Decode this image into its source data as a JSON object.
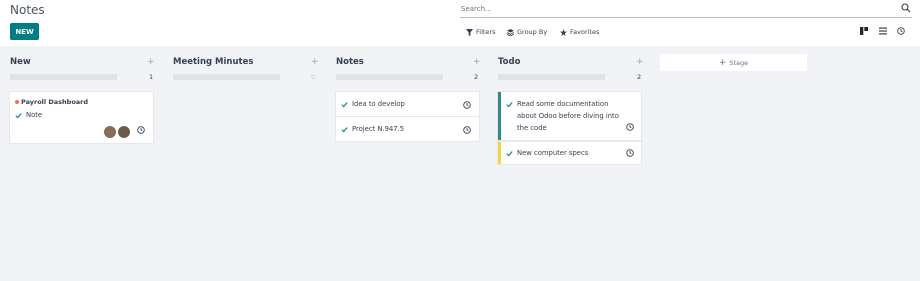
{
  "app": {
    "title": "Notes"
  },
  "control_panel": {
    "new_label": "NEW",
    "search_placeholder": "Search...",
    "filters_label": "Filters",
    "group_by_label": "Group By",
    "favorites_label": "Favorites",
    "views": [
      "kanban-icon",
      "list-icon",
      "activity-icon"
    ]
  },
  "columns": [
    {
      "title": "New",
      "count": "1"
    },
    {
      "title": "Meeting Minutes",
      "count": "0"
    },
    {
      "title": "Notes",
      "count": "2"
    },
    {
      "title": "Todo",
      "count": "2"
    }
  ],
  "cards": {
    "payroll": {
      "title": "Payroll Dashboard",
      "subtitle": "Note"
    },
    "idea": {
      "text": "Idea to develop"
    },
    "project": {
      "text": "Project N.947.5"
    },
    "docs": {
      "line1": "Read some documentation",
      "line2": "about Odoo before diving into",
      "line3": "the code"
    },
    "specs": {
      "text": "New computer specs"
    }
  },
  "add_stage_label": "Stage",
  "colors": {
    "accent": "#017e84",
    "check": "#2f8a8c",
    "dot": "#f06c4e",
    "yellow": "#f5d442"
  }
}
